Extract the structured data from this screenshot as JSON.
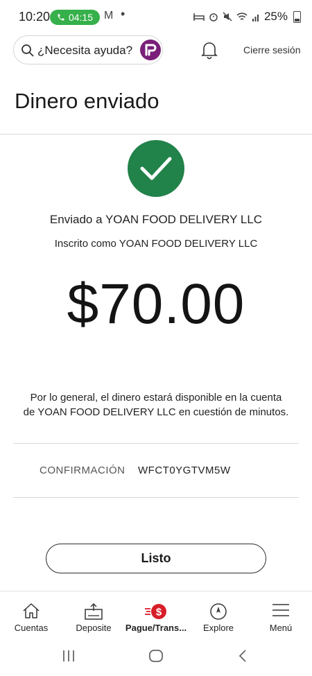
{
  "status_bar": {
    "time": "10:20",
    "call_timer": "04:15",
    "notification_letter": "M",
    "dot": "•",
    "battery": "25%",
    "call_color": "#36b04a"
  },
  "header": {
    "search_placeholder": "¿Necesita ayuda?",
    "logout_label": "Cierre sesión",
    "logo_color": "#7a1f79"
  },
  "page": {
    "title": "Dinero enviado",
    "success_color": "#21824a",
    "sent_to": "Enviado a YOAN FOOD DELIVERY LLC",
    "enrolled_as": "Inscrito como YOAN FOOD DELIVERY LLC",
    "amount": "$70.00",
    "availability_line1": "Por lo general, el dinero estará disponible en la cuenta",
    "availability_line2": "de YOAN FOOD DELIVERY LLC en cuestión de minutos.",
    "confirmation_label": "CONFIRMACIÓN",
    "confirmation_value": "WFCT0YGTVM5W",
    "done_label": "Listo"
  },
  "bottom_nav": {
    "items": [
      {
        "label": "Cuentas",
        "icon": "home-icon"
      },
      {
        "label": "Deposite",
        "icon": "deposit-icon"
      },
      {
        "label": "Pague/Trans...",
        "icon": "pay-transfer-icon",
        "active": true
      },
      {
        "label": "Explore",
        "icon": "compass-icon"
      },
      {
        "label": "Menú",
        "icon": "menu-icon"
      }
    ],
    "accent_color": "#d71e28"
  },
  "system_nav": {
    "buttons": [
      "recent-apps-icon",
      "home-circle-icon",
      "back-icon"
    ]
  }
}
